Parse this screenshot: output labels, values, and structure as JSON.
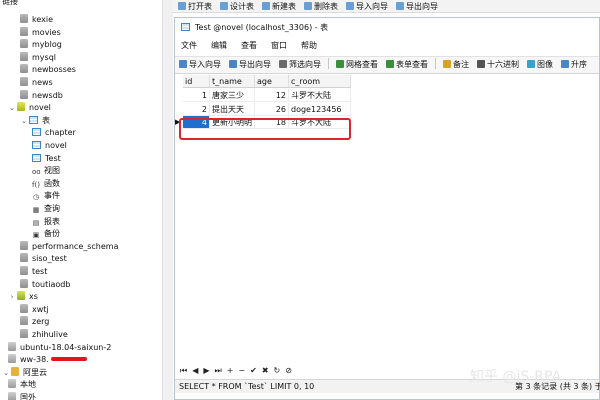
{
  "tree": {
    "header_fragment": "链接",
    "items": [
      {
        "label": "kexie",
        "type": "db"
      },
      {
        "label": "movies",
        "type": "db"
      },
      {
        "label": "myblog",
        "type": "db"
      },
      {
        "label": "mysql",
        "type": "db"
      },
      {
        "label": "newbosses",
        "type": "db"
      },
      {
        "label": "news",
        "type": "db"
      },
      {
        "label": "newsdb",
        "type": "db"
      },
      {
        "label": "novel",
        "type": "db-open"
      },
      {
        "label": "表",
        "type": "folder"
      },
      {
        "label": "chapter",
        "type": "table"
      },
      {
        "label": "novel",
        "type": "table"
      },
      {
        "label": "Test",
        "type": "table"
      },
      {
        "label": "视图",
        "type": "obj",
        "glyph": "oo"
      },
      {
        "label": "函数",
        "type": "obj",
        "glyph": "f()"
      },
      {
        "label": "事件",
        "type": "obj",
        "glyph": "◷"
      },
      {
        "label": "查询",
        "type": "obj",
        "glyph": "▦"
      },
      {
        "label": "报表",
        "type": "obj",
        "glyph": "▤"
      },
      {
        "label": "备份",
        "type": "obj",
        "glyph": "▣"
      },
      {
        "label": "performance_schema",
        "type": "db"
      },
      {
        "label": "siso_test",
        "type": "db"
      },
      {
        "label": "test",
        "type": "db"
      },
      {
        "label": "toutiaodb",
        "type": "db"
      },
      {
        "label": "xs",
        "type": "db-green"
      },
      {
        "label": "xwtj",
        "type": "db"
      },
      {
        "label": "zerg",
        "type": "db"
      },
      {
        "label": "zhihulive",
        "type": "db"
      },
      {
        "label": "ubuntu-18.04-saixun-2",
        "type": "conn"
      },
      {
        "label": "ww-38.",
        "type": "conn-redacted"
      },
      {
        "label": "阿里云",
        "type": "group"
      },
      {
        "label": "本地",
        "type": "conn"
      },
      {
        "label": "国外",
        "type": "conn"
      }
    ]
  },
  "topbar": {
    "items": [
      "打开表",
      "设计表",
      "新建表",
      "删除表",
      "导入向导",
      "导出向导"
    ]
  },
  "window": {
    "title": "Test @novel (localhost_3306) - 表",
    "menu": [
      "文件",
      "编辑",
      "查看",
      "窗口",
      "帮助"
    ],
    "toolbar": [
      "导入向导",
      "导出向导",
      "筛选向导",
      "网格查看",
      "表单查看",
      "备注",
      "十六进制",
      "图像",
      "升序"
    ]
  },
  "grid": {
    "columns": [
      "id",
      "t_name",
      "age",
      "c_room"
    ],
    "rows": [
      {
        "id": "1",
        "t_name": "唐家三少",
        "age": "12",
        "c_room": "斗罗不大陆"
      },
      {
        "id": "2",
        "t_name": "提出天天",
        "age": "26",
        "c_room": "doge123456"
      },
      {
        "id": "4",
        "t_name": "更新小明明",
        "age": "18",
        "c_room": "斗罗不大陆"
      }
    ],
    "selected_row_index": 2
  },
  "navbar": {
    "controls": [
      "⏮",
      "◀",
      "▶",
      "⏭",
      "+",
      "−",
      "✔",
      "✖",
      "↻",
      "⊘"
    ]
  },
  "status": {
    "sql": "SELECT * FROM `Test` LIMIT 0, 10",
    "records": "第 3 条记录 (共 3 条) 于"
  },
  "watermark": "知乎 @iS-RPA",
  "colors": {
    "accent": "#3a86c8",
    "highlight": "#d8262a"
  }
}
